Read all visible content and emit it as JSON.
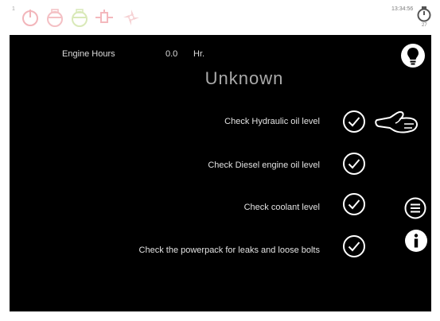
{
  "top_bar": {
    "corner_mark": "1",
    "clock": "13:34:56",
    "timer_sub": "27",
    "icons": [
      "power-icon",
      "engine-temperature-icon",
      "oil-pressure-icon",
      "glow-plug-icon",
      "fan-icon"
    ]
  },
  "engine": {
    "hours_label": "Engine Hours",
    "hours_value": "0.0",
    "hours_unit": "Hr."
  },
  "status_title": "Unknown",
  "checklist": [
    {
      "label": "Check Hydraulic oil level"
    },
    {
      "label": "Check Diesel engine oil level"
    },
    {
      "label": "Check coolant level"
    },
    {
      "label": "Check the powerpack for leaks and loose bolts"
    }
  ],
  "side_buttons": [
    "lightbulb-icon",
    "menu-icon",
    "info-icon"
  ],
  "colors": {
    "screen_bg": "#000000",
    "text": "#e2e2e2",
    "status_icons": "#f2b8bc"
  }
}
